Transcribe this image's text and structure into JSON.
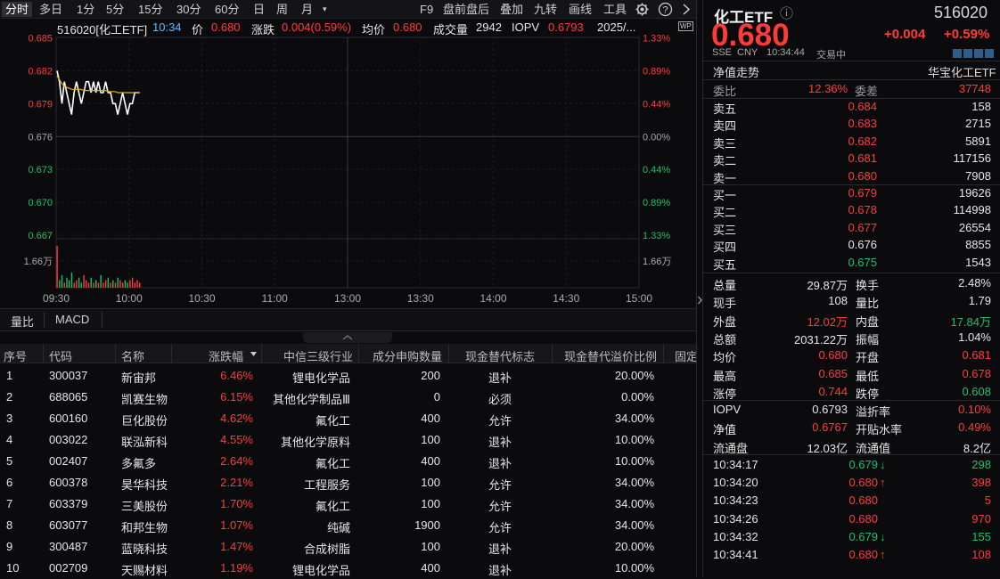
{
  "toolbar": {
    "period_tabs": [
      "分时",
      "多日",
      "1分",
      "5分",
      "15分",
      "30分",
      "60分",
      "日",
      "周",
      "月"
    ],
    "more_arrow": "▾",
    "menu_items": [
      "F9",
      "盘前盘后",
      "叠加",
      "九转",
      "画线",
      "工具"
    ],
    "settings_icon": "gear-icon",
    "help_icon": "help-icon",
    "collapse_icon": "chevron-right-icon"
  },
  "infobar": {
    "code_name": "516020[化工ETF]",
    "time": "10:34",
    "price_label": "价",
    "price": "0.680",
    "change_label": "涨跌",
    "change": "0.004(0.59%)",
    "avg_label": "均价",
    "avg": "0.680",
    "volume_label": "成交量",
    "volume": "2942",
    "iopv_label": "IOPV",
    "iopv": "0.6793",
    "date": "2025/...",
    "wp_icon": "WP"
  },
  "chart_data": {
    "type": "line",
    "y_left_ticks": [
      "0.685",
      "0.682",
      "0.679",
      "0.676",
      "0.673",
      "0.670",
      "0.667"
    ],
    "y_right_ticks": [
      "1.33%",
      "0.89%",
      "0.44%",
      "0.00%",
      "0.44%",
      "0.89%",
      "1.33%"
    ],
    "ylim": [
      0.667,
      0.685
    ],
    "prev_close": 0.676,
    "x_ticks": [
      "09:30",
      "10:00",
      "10:30",
      "11:00",
      "13:00",
      "13:30",
      "14:00",
      "14:30",
      "15:00"
    ],
    "volume_label_left": "1.66万",
    "volume_label_right": "1.66万",
    "price_series": [
      0.682,
      0.681,
      0.679,
      0.681,
      0.68,
      0.679,
      0.678,
      0.68,
      0.681,
      0.68,
      0.679,
      0.68,
      0.681,
      0.681,
      0.68,
      0.681,
      0.68,
      0.681,
      0.68,
      0.68,
      0.681,
      0.68,
      0.68,
      0.679,
      0.679,
      0.678,
      0.679,
      0.68,
      0.679,
      0.678,
      0.679,
      0.679,
      0.68,
      0.68,
      0.68
    ],
    "avg_series": [
      0.6815,
      0.6812,
      0.6808,
      0.6806,
      0.6805,
      0.6804,
      0.6803,
      0.6803,
      0.6803,
      0.6803,
      0.6803,
      0.6802,
      0.6802,
      0.6802,
      0.6802,
      0.6802,
      0.6802,
      0.6802,
      0.6802,
      0.6802,
      0.6802,
      0.6801,
      0.6801,
      0.6801,
      0.6801,
      0.68,
      0.68,
      0.68,
      0.68,
      0.68,
      0.68,
      0.68,
      0.68,
      0.68,
      0.68
    ],
    "volumes": [
      1.66,
      0.3,
      0.5,
      0.2,
      0.4,
      0.3,
      0.6,
      0.2,
      0.3,
      0.4,
      0.2,
      0.5,
      0.3,
      0.2,
      0.4,
      0.2,
      0.3,
      0.2,
      0.5,
      0.2,
      0.3,
      0.4,
      0.2,
      0.3,
      0.2,
      0.4,
      0.3,
      0.2,
      0.3,
      0.2,
      0.3,
      0.4,
      0.2,
      0.3,
      0.2
    ],
    "volume_max": 1.66
  },
  "subtabs": [
    "量比",
    "MACD"
  ],
  "table": {
    "headers": [
      "序号",
      "代码",
      "名称",
      "涨跌幅",
      "中信三级行业",
      "成分申购数量",
      "现金替代标志",
      "现金替代溢价比例",
      "固定"
    ],
    "rows": [
      {
        "no": "1",
        "code": "300037",
        "name": "新宙邦",
        "chg": "6.46%",
        "ind": "锂电化学品",
        "qty": "200",
        "flag": "退补",
        "ratio": "20.00%"
      },
      {
        "no": "2",
        "code": "688065",
        "name": "凯赛生物",
        "chg": "6.15%",
        "ind": "其他化学制品Ⅲ",
        "qty": "0",
        "flag": "必须",
        "ratio": "0.00%"
      },
      {
        "no": "3",
        "code": "600160",
        "name": "巨化股份",
        "chg": "4.62%",
        "ind": "氟化工",
        "qty": "400",
        "flag": "允许",
        "ratio": "34.00%"
      },
      {
        "no": "4",
        "code": "003022",
        "name": "联泓新科",
        "chg": "4.55%",
        "ind": "其他化学原料",
        "qty": "100",
        "flag": "退补",
        "ratio": "10.00%"
      },
      {
        "no": "5",
        "code": "002407",
        "name": "多氟多",
        "chg": "2.64%",
        "ind": "氟化工",
        "qty": "400",
        "flag": "退补",
        "ratio": "10.00%"
      },
      {
        "no": "6",
        "code": "600378",
        "name": "昊华科技",
        "chg": "2.21%",
        "ind": "工程服务",
        "qty": "100",
        "flag": "允许",
        "ratio": "34.00%"
      },
      {
        "no": "7",
        "code": "603379",
        "name": "三美股份",
        "chg": "1.70%",
        "ind": "氟化工",
        "qty": "100",
        "flag": "允许",
        "ratio": "34.00%"
      },
      {
        "no": "8",
        "code": "603077",
        "name": "和邦生物",
        "chg": "1.07%",
        "ind": "纯碱",
        "qty": "1900",
        "flag": "允许",
        "ratio": "34.00%"
      },
      {
        "no": "9",
        "code": "300487",
        "name": "蓝晓科技",
        "chg": "1.47%",
        "ind": "合成树脂",
        "qty": "100",
        "flag": "退补",
        "ratio": "20.00%"
      },
      {
        "no": "10",
        "code": "002709",
        "name": "天赐材料",
        "chg": "1.19%",
        "ind": "锂电化学品",
        "qty": "400",
        "flag": "退补",
        "ratio": "10.00%"
      }
    ]
  },
  "quote": {
    "name": "化工ETF",
    "info_icon": "ⓘ",
    "code": "516020",
    "price": "0.680",
    "change": "+0.004",
    "change_pct": "+0.59%",
    "exchange": "SSE",
    "currency": "CNY",
    "time": "10:34:44",
    "status": "交易中",
    "nav_trend": "净值走势",
    "fund_name": "华宝化工ETF",
    "wei_bi_label": "委比",
    "wei_bi": "12.36%",
    "wei_cha_label": "委差",
    "wei_cha": "37748",
    "asks": [
      {
        "label": "卖五",
        "price": "0.684",
        "vol": "158"
      },
      {
        "label": "卖四",
        "price": "0.683",
        "vol": "2715"
      },
      {
        "label": "卖三",
        "price": "0.682",
        "vol": "5891"
      },
      {
        "label": "卖二",
        "price": "0.681",
        "vol": "117156"
      },
      {
        "label": "卖一",
        "price": "0.680",
        "vol": "7908"
      }
    ],
    "bids": [
      {
        "label": "买一",
        "price": "0.679",
        "vol": "19626",
        "color": "red"
      },
      {
        "label": "买二",
        "price": "0.678",
        "vol": "114998",
        "color": "red"
      },
      {
        "label": "买三",
        "price": "0.677",
        "vol": "26554",
        "color": "red"
      },
      {
        "label": "买四",
        "price": "0.676",
        "vol": "8855",
        "color": "white"
      },
      {
        "label": "买五",
        "price": "0.675",
        "vol": "1543",
        "color": "green"
      }
    ],
    "stats": [
      {
        "l1": "总量",
        "v1": "29.87万",
        "c1": "white",
        "l2": "换手",
        "v2": "2.48%",
        "c2": "white"
      },
      {
        "l1": "现手",
        "v1": "108",
        "c1": "white",
        "l2": "量比",
        "v2": "1.79",
        "c2": "white"
      },
      {
        "l1": "外盘",
        "v1": "12.02万",
        "c1": "red",
        "l2": "内盘",
        "v2": "17.84万",
        "c2": "green"
      },
      {
        "l1": "总额",
        "v1": "2031.22万",
        "c1": "white",
        "l2": "振幅",
        "v2": "1.04%",
        "c2": "white"
      },
      {
        "l1": "均价",
        "v1": "0.680",
        "c1": "red",
        "l2": "开盘",
        "v2": "0.681",
        "c2": "red"
      },
      {
        "l1": "最高",
        "v1": "0.685",
        "c1": "red",
        "l2": "最低",
        "v2": "0.678",
        "c2": "red"
      },
      {
        "l1": "涨停",
        "v1": "0.744",
        "c1": "red",
        "l2": "跌停",
        "v2": "0.608",
        "c2": "green"
      }
    ],
    "iopv_stats": [
      {
        "l1": "IOPV",
        "v1": "0.6793",
        "c1": "white",
        "l2": "溢折率",
        "v2": "0.10%",
        "c2": "red"
      },
      {
        "l1": "净值",
        "v1": "0.6767",
        "c1": "red",
        "l2": "开贴水率",
        "v2": "0.49%",
        "c2": "red"
      },
      {
        "l1": "流通盘",
        "v1": "12.03亿",
        "c1": "white",
        "l2": "流通值",
        "v2": "8.2亿",
        "c2": "white"
      }
    ],
    "ticks": [
      {
        "time": "10:34:17",
        "price": "0.679",
        "arrow": "↓",
        "ac": "green",
        "vol": "298",
        "vc": "green"
      },
      {
        "time": "10:34:20",
        "price": "0.680",
        "arrow": "↑",
        "ac": "red",
        "vol": "398",
        "vc": "red"
      },
      {
        "time": "10:34:23",
        "price": "0.680",
        "arrow": "",
        "ac": "red",
        "vol": "5",
        "vc": "red"
      },
      {
        "time": "10:34:26",
        "price": "0.680",
        "arrow": "",
        "ac": "red",
        "vol": "970",
        "vc": "red"
      },
      {
        "time": "10:34:32",
        "price": "0.679",
        "arrow": "↓",
        "ac": "green",
        "vol": "155",
        "vc": "green"
      },
      {
        "time": "10:34:41",
        "price": "0.680",
        "arrow": "↑",
        "ac": "red",
        "vol": "108",
        "vc": "red"
      }
    ]
  },
  "colors": {
    "up": "#ff3b3b",
    "down": "#18c26b",
    "avg_line": "#e0b020",
    "price_line": "#ffffff"
  }
}
